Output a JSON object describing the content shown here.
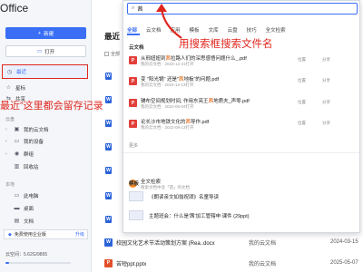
{
  "app": {
    "title": "Office"
  },
  "sidebar": {
    "new_label": "新建",
    "open_label": "打开",
    "nav": [
      {
        "label": "最近",
        "icon": "clock-icon"
      },
      {
        "label": "星标",
        "icon": "star-icon"
      },
      {
        "label": "共享",
        "icon": "share-icon"
      }
    ],
    "cloud_section": "云盘",
    "cloud_items": [
      {
        "label": "我的云文档",
        "icon": "cloud-folder-icon"
      },
      {
        "label": "我的设备",
        "icon": "device-icon"
      },
      {
        "label": "群组",
        "icon": "group-icon"
      },
      {
        "label": "回收站",
        "icon": "trash-icon"
      }
    ],
    "local_section": "本地",
    "local_items": [
      {
        "label": "此电脑",
        "icon": "computer-icon"
      },
      {
        "label": "桌面",
        "icon": "desktop-icon"
      },
      {
        "label": "文档",
        "icon": "document-folder-icon"
      }
    ],
    "storage_box_label": "免费使用企业版",
    "storage_box_action": "升级",
    "storage_label": "云空间：",
    "storage_value": "5.62G/9865",
    "storage_fraction": 0.06
  },
  "main": {
    "title": "最近",
    "select_all": "全部",
    "rows": [
      {
        "name": "校园文化艺术节活动策划方案 (Rea..docx",
        "location": "我的云文档",
        "date": "2024-03-15",
        "icon": "W",
        "color": "#2b63d9"
      },
      {
        "name": "苦短ppt.pptx",
        "location": "我的云文档",
        "date": "2025-05-07",
        "icon": "P",
        "color": "#e2502b"
      }
    ]
  },
  "search": {
    "query": "茜",
    "tabs": [
      "全部",
      "云文档",
      "应用",
      "模板",
      "文库",
      "云盘",
      "技巧",
      "全文检索"
    ],
    "cloud_section": "云文档",
    "results": [
      {
        "pre": "从邢妞妞到",
        "hl": "茜",
        "post": "拉路人们的深思感悟问题什么_.pdf",
        "sub": "我的云文档 · 2023-12-21打开",
        "icon": "P",
        "color": "#e23f3a"
      },
      {
        "pre": "变 \"阳光锅\" 还是\"",
        "hl": "茜",
        "post": "地板\"的问题.pdf",
        "sub": "我的云文档 · 2022-12-13打开",
        "icon": "P",
        "color": "#e23f3a"
      },
      {
        "pre": "辅布空间规划时间, 作用东亮王",
        "hl": "茜",
        "post": "地质夫_声零.pdf",
        "sub": "我的云文档 · 2022-05-04打开",
        "icon": "P",
        "color": "#e23f3a"
      },
      {
        "pre": "论长沙市地铁文化的",
        "hl": "茜",
        "post": "导作.pdf",
        "sub": "我的云文档 · 2022-09-13打开",
        "icon": "P",
        "color": "#e23f3a"
      }
    ],
    "result_action_open": "位置",
    "result_action_share": "分享",
    "more_label": "更多",
    "fulltext_title": "全文检索",
    "fulltext_sub": "搜索文档中含「茜」的文档",
    "template_section": "模板",
    "templates": [
      "《朗读亲文如翁祝颂》名童导读",
      "主题班会：什么是'茜'加工管辖申 课件 (29ppt)"
    ]
  },
  "annotations": {
    "search_hint": "用搜索框搜索文件名",
    "recent_hint": "最近”这里都会留存记录"
  }
}
